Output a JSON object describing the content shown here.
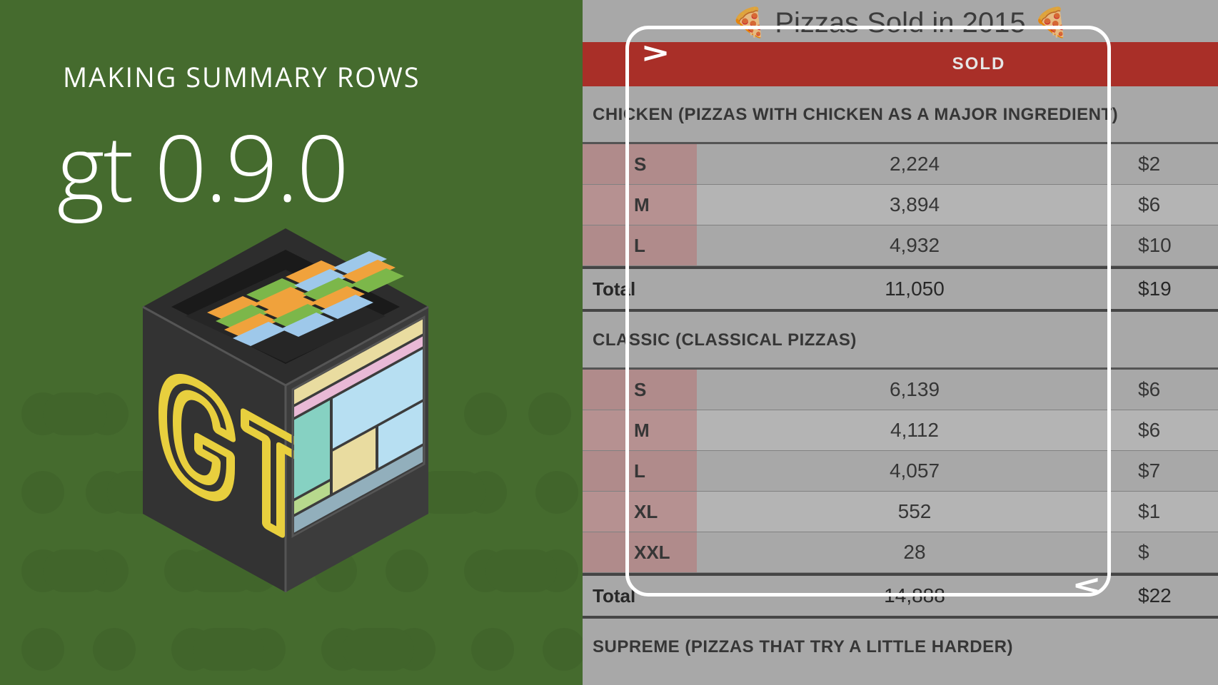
{
  "left": {
    "subtitle": "MAKING SUMMARY ROWS",
    "title": "gt 0.9.0"
  },
  "table": {
    "title": "🍕 Pizzas Sold in 2015 🍕",
    "header_sold": "SOLD",
    "groups": [
      {
        "label": "CHICKEN (PIZZAS WITH CHICKEN AS A MAJOR INGREDIENT)",
        "rows": [
          {
            "size": "S",
            "sold": "2,224",
            "inc": "$2"
          },
          {
            "size": "M",
            "sold": "3,894",
            "inc": "$6"
          },
          {
            "size": "L",
            "sold": "4,932",
            "inc": "$10"
          }
        ],
        "total": {
          "label": "Total",
          "sold": "11,050",
          "inc": "$19"
        }
      },
      {
        "label": "CLASSIC (CLASSICAL PIZZAS)",
        "rows": [
          {
            "size": "S",
            "sold": "6,139",
            "inc": "$6"
          },
          {
            "size": "M",
            "sold": "4,112",
            "inc": "$6"
          },
          {
            "size": "L",
            "sold": "4,057",
            "inc": "$7"
          },
          {
            "size": "XL",
            "sold": "552",
            "inc": "$1"
          },
          {
            "size": "XXL",
            "sold": "28",
            "inc": "$"
          }
        ],
        "total": {
          "label": "Total",
          "sold": "14,888",
          "inc": "$22"
        }
      },
      {
        "label": "SUPREME (PIZZAS THAT TRY A LITTLE HARDER)",
        "rows": [],
        "total": null
      }
    ]
  },
  "frame": {
    "mark_top": ">",
    "mark_bottom": "<"
  }
}
